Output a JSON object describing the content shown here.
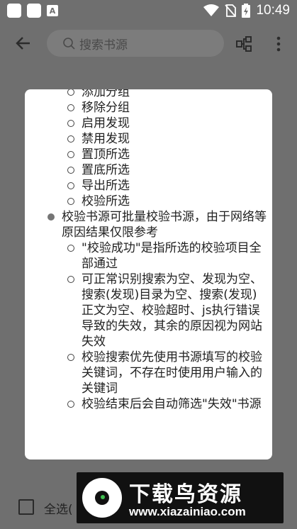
{
  "status_bar": {
    "time": "10:49",
    "left_icons": [
      "app-icon",
      "app-icon",
      "font-icon"
    ],
    "right_icons": [
      "wifi-icon",
      "no-sim-icon",
      "battery-charging-icon"
    ]
  },
  "toolbar": {
    "search_placeholder": "搜索书源",
    "icons": [
      "back-arrow-icon",
      "search-icon",
      "group-icon",
      "more-vert-icon"
    ]
  },
  "dialog": {
    "top_items": [
      "添加分组",
      "移除分组",
      "启用发现",
      "禁用发现",
      "置顶所选",
      "置底所选",
      "导出所选",
      "校验所选"
    ],
    "check_note": "校验书源可批量校验书源，由于网络等原因结果仅限参考",
    "check_subitems": [
      "\"校验成功\"是指所选的校验项目全部通过",
      "可正常识别搜索为空、发现为空、搜索(发现)目录为空、搜索(发现)正文为空、校验超时、js执行错误导致的失效，其余的原因视为网站失效",
      "校验搜索优先使用书源填写的校验关键词，不存在时使用用户输入的关键词",
      "校验结束后会自动筛选\"失效\"书源"
    ]
  },
  "bottom": {
    "select_all_label": "全选("
  },
  "watermark": {
    "title": "下载鸟资源",
    "url": "www.xiazainiao.com"
  },
  "colors": {
    "scrim": "#6f6f6f",
    "dialog_bg": "#ffffff",
    "accent_green": "#3fbf4f"
  }
}
